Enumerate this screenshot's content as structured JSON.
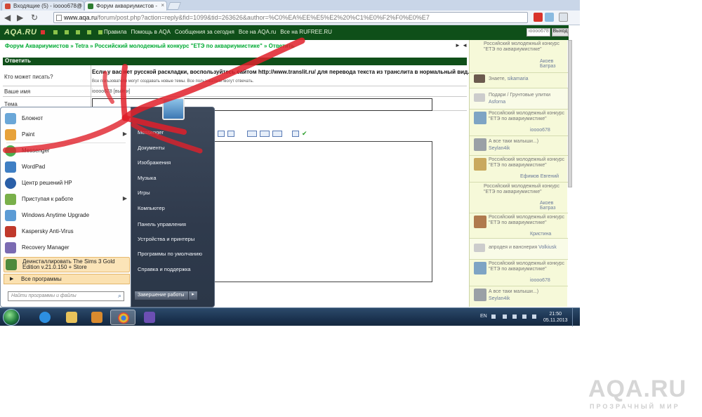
{
  "browser": {
    "tabs": [
      {
        "label": "Входящие (5) - ioooo678@",
        "icon_color": "#d14836"
      },
      {
        "label": "Форум аквариумистов - ",
        "icon_color": "#2e7d32"
      }
    ],
    "url_main": "www.aqa.ru",
    "url_rest": "/forum/post.php?action=reply&fid=1099&tid=263626&author=%C0%EA%EE%E5%E2%20%C1%E0%F2%F0%E0%E7"
  },
  "site_nav": {
    "logo": "AQA.RU",
    "links": [
      "Правила",
      "Помощь в AQA",
      "Сообщения за сегодня",
      "Все на AQA.ru",
      "Все на RUFREE.RU"
    ],
    "user": "ioooo678",
    "exit": "Выход"
  },
  "page": {
    "breadcrumb": "Форум Аквариумистов » Tetra » Российский молодежный конкурс \"ЕТЭ по аквариумистике\" » Ответить",
    "pager": "► ◄ ◄",
    "reply_header": "Ответить",
    "rows": {
      "who_can_write": "Кто может писать?",
      "your_name": "Ваше имя",
      "subject": "Тема"
    },
    "notice": "Если у вас нет русской раскладки, воспользуйтесь сайтом http://www.translit.ru/ для перевода текста из транслита в нормальный вид.",
    "notice2": "Все пользователи могут создавать новые темы. Все пользователи могут отвечать.",
    "name_value": "ioooo678 [выйти]"
  },
  "sidebar": [
    {
      "title": "Российский молодежный конкурс \"ЕТЭ по аквариумистике\"",
      "author": "Акоев Батраз"
    },
    {
      "title": "Знаете,",
      "author": "sikamaria"
    },
    {
      "title": "Подари / Грунтовые улитки",
      "author": "Asforna"
    },
    {
      "title": "Российский молодежный конкурс \"ЕТЭ по аквариумистике\"",
      "author": "ioooo678"
    },
    {
      "title": "А все таки малыши...)",
      "author": "Seylan4ik"
    },
    {
      "title": "Российский молодежный конкурс \"ЕТЭ по аквариумистике\"",
      "author": "Ефимов Евгений"
    },
    {
      "title": "Российский молодежный конкурс \"ЕТЭ по аквариумистике\"",
      "author": "Акоев Батраз"
    },
    {
      "title": "Российский молодежный конкурс \"ЕТЭ по аквариумистике\"",
      "author": "Кристина"
    },
    {
      "title": "апродея и ванснерия",
      "author": "Volkiusk"
    },
    {
      "title": "Российский молодежный конкурс \"ЕТЭ по аквариумистике\"",
      "author": "ioooo678"
    },
    {
      "title": "А все таки малыши...)",
      "author": "Seylan4ik"
    }
  ],
  "start_menu": {
    "apps": [
      {
        "label": "Блокнот",
        "color": "#6aa7d8"
      },
      {
        "label": "Paint",
        "color": "#e7a23b"
      },
      {
        "label": "Messenger",
        "color": "#4caf50"
      },
      {
        "label": "WordPad",
        "color": "#3f7fc4"
      },
      {
        "label": "Центр решений HP",
        "color": "#2a5fa8"
      },
      {
        "label": "Приступая к работе",
        "color": "#79b04a"
      },
      {
        "label": "Windows Anytime Upgrade",
        "color": "#5b9bd5"
      },
      {
        "label": "Kaspersky Anti-Virus",
        "color": "#c0392b"
      },
      {
        "label": "Recovery Manager",
        "color": "#7b6bb2"
      },
      {
        "label": "Деинсталлировать The Sims 3 Gold Edition v.21.0.150 + Store",
        "color": "#4e8a3c"
      }
    ],
    "all_programs": "Все программы",
    "search_placeholder": "Найти программы и файлы",
    "right": [
      "Messenger",
      "Документы",
      "Изображения",
      "Музыка",
      "Игры",
      "Компьютер",
      "Панель управления",
      "Устройства и принтеры",
      "Программы по умолчанию",
      "Справка и поддержка"
    ],
    "shutdown": "Завершение работы"
  },
  "taskbar": {
    "lang": "EN",
    "time": "21:50",
    "date": "05.11.2013"
  },
  "watermark": {
    "logo": "AQA.RU",
    "tagline": "ПРОЗРАЧНЫЙ МИР"
  }
}
